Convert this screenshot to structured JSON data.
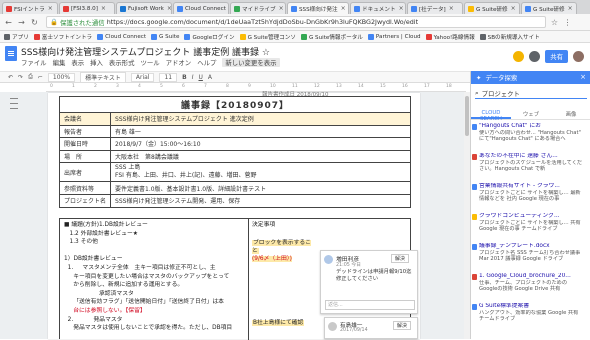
{
  "tabs": [
    {
      "label": "FSIイントラ",
      "color": "#e53935"
    },
    {
      "label": "[FSI3.8.0]",
      "color": "#e53935"
    },
    {
      "label": "Fujisoft Work",
      "color": "#1976d2"
    },
    {
      "label": "Cloud Connect",
      "color": "#4285f4"
    },
    {
      "label": "マイドライブ",
      "color": "#34a853"
    },
    {
      "label": "SSS様向け発注",
      "color": "#4285f4"
    },
    {
      "label": "ドキュメント",
      "color": "#4285f4"
    },
    {
      "label": "[社データ]",
      "color": "#4285f4"
    },
    {
      "label": "G Suite研修",
      "color": "#fbbc05"
    },
    {
      "label": "G Suite研修",
      "color": "#4285f4"
    }
  ],
  "address": {
    "secure": "保護された通信",
    "url": "https://docs.google.com/document/d/1deUaaTzt5hYdjdDoSbu-DnGbKr9h3luFQKBG2Jwydl.Wo/edit"
  },
  "bookmarks": [
    {
      "label": "アプリ",
      "color": "#5f6368"
    },
    {
      "label": "富士ソフトイントラ",
      "color": "#e53935"
    },
    {
      "label": "Cloud Connect",
      "color": "#4285f4"
    },
    {
      "label": "G Suite",
      "color": "#4285f4"
    },
    {
      "label": "Googleログイン",
      "color": "#4285f4"
    },
    {
      "label": "G Suite管理コンソ",
      "color": "#fbbc05"
    },
    {
      "label": "G Suite情報ポータル",
      "color": "#34a853"
    },
    {
      "label": "Partners | Cloud",
      "color": "#4285f4"
    },
    {
      "label": "Yahoo!路線情報",
      "color": "#e53935"
    },
    {
      "label": "SBの新規導入サイト",
      "color": "#5f6368"
    }
  ],
  "doc": {
    "title": "SSS様向け発注管理システムプロジェクト 議事定例 議事録 ☆",
    "menus": [
      "ファイル",
      "編集",
      "表示",
      "挿入",
      "表示形式",
      "ツール",
      "アドオン",
      "ヘルプ"
    ],
    "last_edit": "新しい変更を表示",
    "share": "共有",
    "toolbar": [
      "100%",
      "標準テキスト",
      "Arial",
      "11",
      "B",
      "I",
      "U",
      "A"
    ],
    "stamp": "報告書作成日 2018/09/10"
  },
  "minutes": {
    "title": "議事録【20180907】",
    "rows": [
      {
        "label": "会議名",
        "value": "SSS様向け発注管理システムプロジェクト 進次定例",
        "hl": true
      },
      {
        "label": "報告者",
        "value": "有島 雄一",
        "hl": false
      },
      {
        "label": "開催日時",
        "value": "2018/9/7（金）15:00〜16:10",
        "hl": false
      },
      {
        "label": "場　所",
        "value": "大阪本社　第8講会議議",
        "hl": false
      },
      {
        "label": "出席者",
        "value": "SSS 上島\nFSI 有島、上田、井口、井上(記)、遠藤、増田、菅野",
        "hl": false
      },
      {
        "label": "参照資料等",
        "value": "要件定義書1.0版、基本設計書1.0版、詳細設計書テスト",
        "hl": false
      },
      {
        "label": "プロジェクト名",
        "value": "SSS様向け発注管理システム開発、運用、保存",
        "hl": false
      }
    ],
    "body_left": [
      "■ 議題(方針)1.DB設計レビュー",
      "   1.2 外部設計書レビュー★",
      "   1.3 その他",
      "",
      "1）DB設計書レビュー",
      "  1.     マスタメンテ全体　主キー項目は修正不可とし、主",
      "     キー項目を変更したい場合はマスタのバックアップをとって",
      "     から削除し、新規に追加する運用とする。",
      "                   承認済マスタ",
      "     「送信有効フラグ」「送信開始日付」「送信終了日付」は本",
      "     台には参照しない。【保留】",
      "  2.           発品マスタ",
      "     発品マスタは使用しないことで承認を得た。ただし、DB項目"
    ],
    "body_right": {
      "title": "決定事項",
      "line1": "ブロックを表示すること",
      "line2": "(9/6〆（上田）)",
      "line3": "B社上島様にて確認"
    }
  },
  "comments": [
    {
      "name": "増田利彦",
      "time": "21:05 今日",
      "resolve": "解決",
      "text": "デッドラインは申請月報9/10迄修正してください",
      "reply": "返信..."
    },
    {
      "name": "有島雄一",
      "time": "2017/09/14",
      "resolve": "解決"
    }
  ],
  "panel": {
    "header": "データ探索",
    "query": "プロジェクト",
    "tabs": [
      "CLOUD SEARCH",
      "ウェブ",
      "画像"
    ],
    "results": [
      {
        "title": "\"Hangouts Chat\" にお",
        "desc": "使い方への問い合わせ... \"Hangouts Chat\" にて\"Hangouts Chat\" にある場合へ",
        "color": "#4285f4"
      },
      {
        "title": "あなたの不在中に 遠藤 さん...",
        "desc": "プロジェクトのスケジュールを活用してください。Hangouts Chat で新",
        "color": "#db4437"
      },
      {
        "title": "営業情報共有サイト - クラウ...",
        "desc": "プロジェクトごとに サイトを構築し... 最新情報などを 社内 Google 現在の事",
        "color": "#4285f4"
      },
      {
        "title": "クラウドコンピューティング...",
        "desc": "プロジェクトごとに サイトを構築し... 共有Google 現在の事 チームドライブ",
        "color": "#fbbc05"
      },
      {
        "title": "議事録_テンプレート.docx",
        "desc": "プロジェクト名 SSS チーム打ち合わせ議事 Mar 2017 議事録 Google ドライブ",
        "color": "#4285f4"
      },
      {
        "title": "1. Google_Cloud_brochure_20...",
        "desc": "仕事、チーム、プロジェクトのための Googleの技術 Google Drive 共有",
        "color": "#db4437"
      },
      {
        "title": "G Suite標準提案書",
        "desc": "ハングアウト、効率的な協業 Google 共有 チームドライブ",
        "color": "#4285f4"
      }
    ]
  }
}
